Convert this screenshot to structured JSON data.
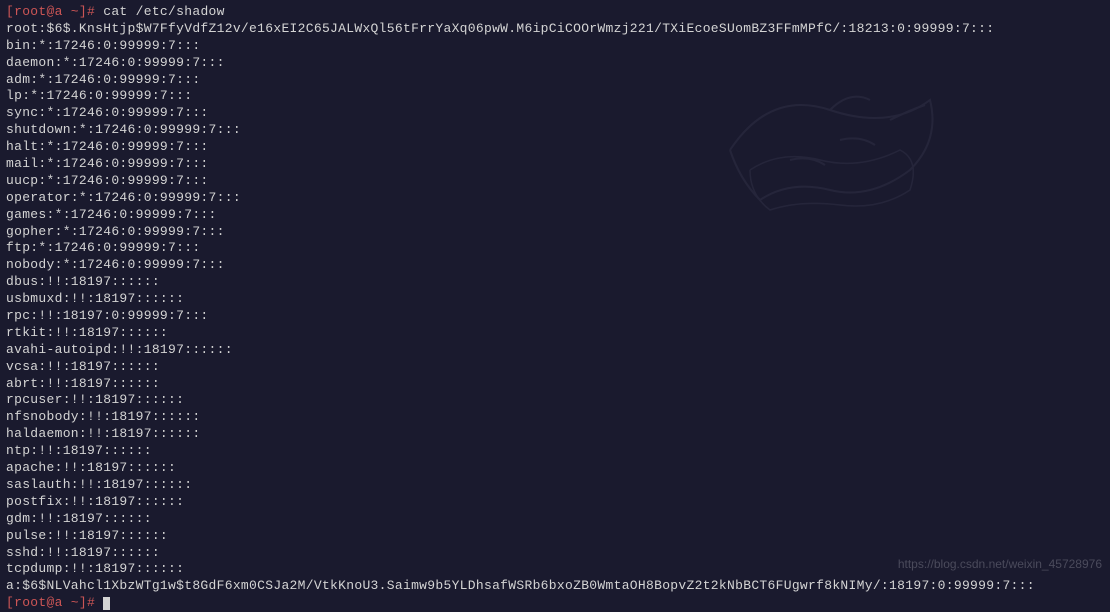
{
  "prompt": {
    "user_host": "[root@a ~]#",
    "command": " cat /etc/shadow"
  },
  "shadow_lines": [
    "root:$6$.KnsHtjp$W7FfyVdfZ12v/e16xEI2C65JALWxQl56tFrrYaXq06pwW.M6ipCiCOOrWmzj221/TXiEcoeSUomBZ3FFmMPfC/:18213:0:99999:7:::",
    "bin:*:17246:0:99999:7:::",
    "daemon:*:17246:0:99999:7:::",
    "adm:*:17246:0:99999:7:::",
    "lp:*:17246:0:99999:7:::",
    "sync:*:17246:0:99999:7:::",
    "shutdown:*:17246:0:99999:7:::",
    "halt:*:17246:0:99999:7:::",
    "mail:*:17246:0:99999:7:::",
    "uucp:*:17246:0:99999:7:::",
    "operator:*:17246:0:99999:7:::",
    "games:*:17246:0:99999:7:::",
    "gopher:*:17246:0:99999:7:::",
    "ftp:*:17246:0:99999:7:::",
    "nobody:*:17246:0:99999:7:::",
    "dbus:!!:18197::::::",
    "usbmuxd:!!:18197::::::",
    "rpc:!!:18197:0:99999:7:::",
    "rtkit:!!:18197::::::",
    "avahi-autoipd:!!:18197::::::",
    "vcsa:!!:18197::::::",
    "abrt:!!:18197::::::",
    "rpcuser:!!:18197::::::",
    "nfsnobody:!!:18197::::::",
    "haldaemon:!!:18197::::::",
    "ntp:!!:18197::::::",
    "apache:!!:18197::::::",
    "saslauth:!!:18197::::::",
    "postfix:!!:18197::::::",
    "gdm:!!:18197::::::",
    "pulse:!!:18197::::::",
    "sshd:!!:18197::::::",
    "tcpdump:!!:18197::::::",
    "a:$6$NLVahcl1XbzWTg1w$t8GdF6xm0CSJa2M/VtkKnoU3.Saimw9b5YLDhsafWSRb6bxoZB0WmtaOH8BopvZ2t2kNbBCT6FUgwrf8kNIMy/:18197:0:99999:7:::"
  ],
  "prompt2": {
    "user_host": "[root@a ~]#",
    "cursor": " "
  },
  "watermark": "https://blog.csdn.net/weixin_45728976"
}
